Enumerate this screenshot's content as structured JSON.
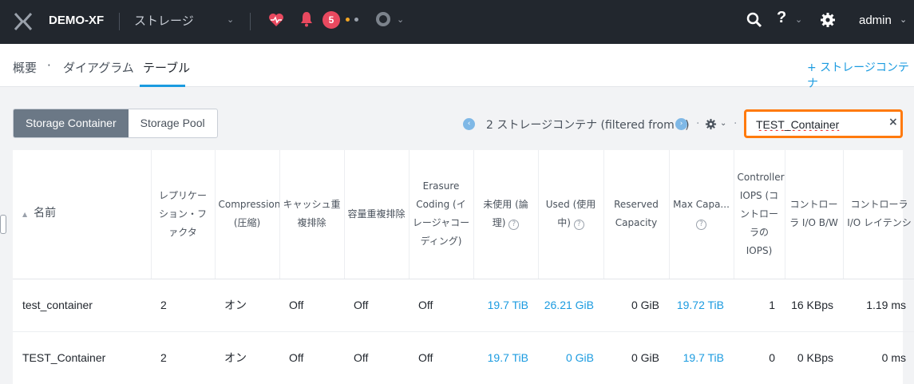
{
  "topbar": {
    "cluster": "DEMO-XF",
    "section": "ストレージ",
    "alert_count": "5",
    "user": "admin"
  },
  "subnav": {
    "items": [
      "概要",
      "ダイアグラム",
      "テーブル"
    ],
    "active": "テーブル",
    "add_label": "+ ストレージコンテナ"
  },
  "toolbar": {
    "segments": [
      "Storage Container",
      "Storage Pool"
    ],
    "active_segment": "Storage Container",
    "count_text": "2 ストレージコンテナ (filtered from 5)",
    "filter_value": "TEST_Container"
  },
  "table": {
    "columns": [
      "名前",
      "レプリケーション・ファクタ",
      "Compression (圧縮)",
      "キャッシュ重複排除",
      "容量重複排除",
      "Erasure Coding (イレージャコーディング)",
      "未使用 (論理)",
      "Used (使用中)",
      "Reserved Capacity",
      "Max Capa...",
      "Controller IOPS (コントローラのIOPS)",
      "コントローラ I/O B/W",
      "コントローラ I/O レイテンシ"
    ],
    "rows": [
      {
        "name": "test_container",
        "rf": "2",
        "compression": "オン",
        "cache_dedup": "Off",
        "capacity_dedup": "Off",
        "erasure": "Off",
        "free": "19.7 TiB",
        "used": "26.21 GiB",
        "reserved": "0 GiB",
        "max": "19.72 TiB",
        "iops": "1",
        "bw": "16 KBps",
        "latency": "1.19 ms"
      },
      {
        "name": "TEST_Container",
        "rf": "2",
        "compression": "オン",
        "cache_dedup": "Off",
        "capacity_dedup": "Off",
        "erasure": "Off",
        "free": "19.7 TiB",
        "used": "0 GiB",
        "reserved": "0 GiB",
        "max": "19.7 TiB",
        "iops": "0",
        "bw": "0 KBps",
        "latency": "0 ms"
      }
    ]
  },
  "colors": {
    "topbar": "#22272e",
    "accent": "#1b9be0",
    "alert": "#e8495f",
    "highlight": "#ff7a0d"
  }
}
